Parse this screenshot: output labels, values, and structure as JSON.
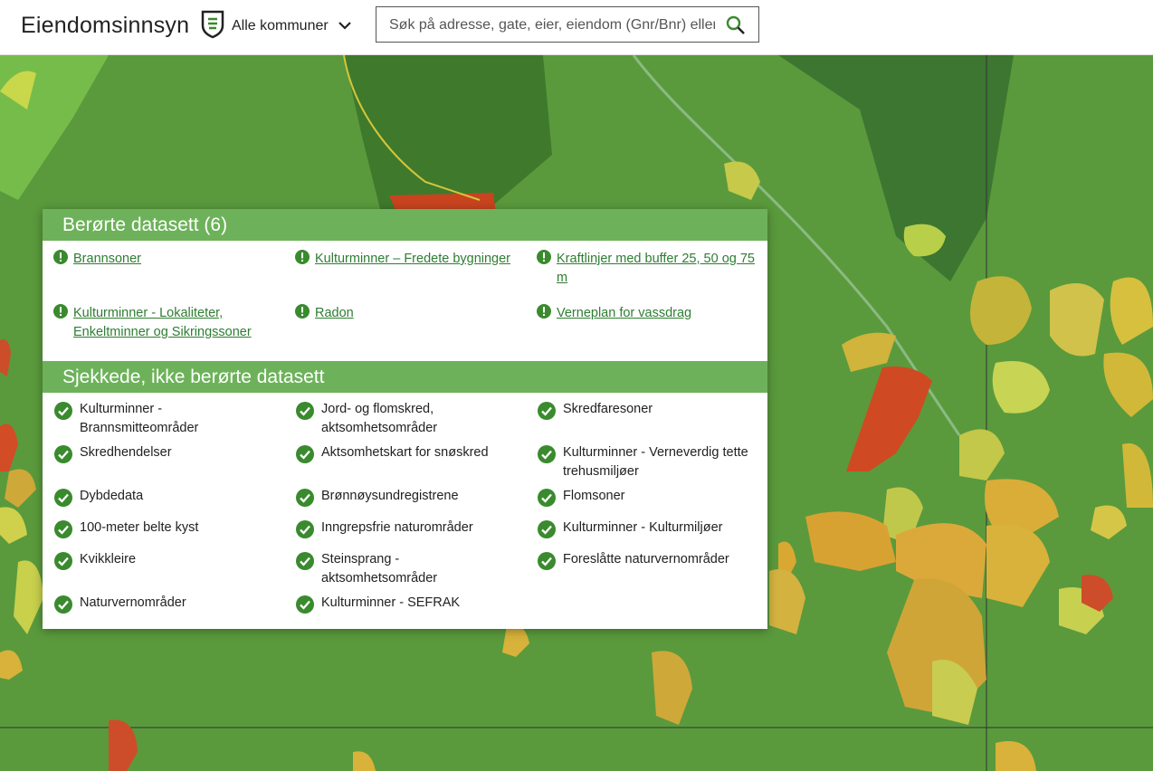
{
  "header": {
    "app_title": "Eiendomsinnsyn",
    "municipality": "Alle kommuner",
    "search_placeholder": "Søk på adresse, gate, eier, eiendom (Gnr/Bnr) eller"
  },
  "affected": {
    "title": "Berørte datasett (6)",
    "items": [
      "Brannsoner",
      "Kulturminner – Fredete bygninger",
      "Kraftlinjer med buffer 25, 50 og 75 m",
      "Kulturminner - Lokaliteter, Enkeltminner og Sikringssoner",
      "Radon",
      "Verneplan for vassdrag"
    ]
  },
  "checked": {
    "title": "Sjekkede, ikke berørte datasett",
    "items": [
      "Kulturminner - Brannsmitteområder",
      "Jord- og flomskred, aktsomhetsområder",
      "Skredfaresoner",
      "Skredhendelser",
      "Aktsomhetskart for snøskred",
      "Kulturminner - Verneverdig tette trehusmiljøer",
      "Dybdedata",
      "Brønnøysundregistrene",
      "Flomsoner",
      "100-meter belte kyst",
      "Inngrepsfrie naturområder",
      "Kulturminner - Kulturmiljøer",
      "Kvikkleire",
      "Steinsprang - aktsomhetsområder",
      "Foreslåtte naturvernområder",
      "Naturvernområder",
      "Kulturminner - SEFRAK"
    ]
  },
  "colors": {
    "accent_green": "#6db25a",
    "link_green": "#2e7d32",
    "check_green": "#3a8a2e",
    "map_base": "#5c9a3e"
  }
}
